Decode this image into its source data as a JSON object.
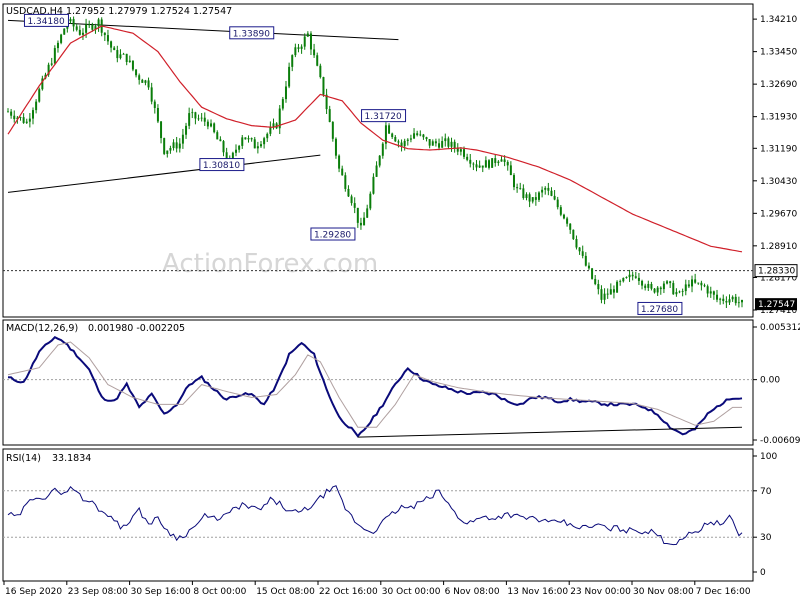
{
  "header": {
    "symbol_line": "USDCAD,H4  1.27952 1.27979 1.27524 1.27547",
    "watermark": "ActionForex.com"
  },
  "colors": {
    "candle": "#0a7d0a",
    "ma": "#d0202a",
    "macd": "#0a0a7a",
    "signal": "#b0a0a0",
    "trend": "#000000",
    "label_border": "#1a1a8a",
    "grid_dash": "#a0a0a0"
  },
  "chart_data": [
    {
      "type": "candlestick",
      "title": "USDCAD,H4",
      "ohlc_header": "1.27952 1.27979 1.27524 1.27547",
      "ylim": [
        1.2741,
        1.3447
      ],
      "y_ticks": [
        "1.34210",
        "1.33450",
        "1.32690",
        "1.31930",
        "1.31190",
        "1.30430",
        "1.29670",
        "1.28910",
        "1.28170",
        "1.27410"
      ],
      "y_tick_values": [
        1.3421,
        1.3345,
        1.3269,
        1.3193,
        1.3119,
        1.3043,
        1.2967,
        1.2891,
        1.2817,
        1.2741
      ],
      "price_anchors": {
        "x": [
          0,
          6,
          12,
          19,
          23,
          29,
          34,
          38,
          41,
          45,
          50,
          55,
          58,
          64,
          71,
          75,
          79,
          84,
          86,
          91,
          96,
          101,
          106,
          110,
          113,
          116,
          121,
          126,
          130,
          135,
          140,
          145,
          150,
          155,
          158,
          163,
          168,
          172,
          179,
          184,
          190,
          196,
          201,
          206,
          210,
          215,
          218,
          223,
          227,
          232,
          235
        ],
        "y": [
          1.3205,
          1.318,
          1.329,
          1.3418,
          1.339,
          1.3415,
          1.334,
          1.333,
          1.329,
          1.327,
          1.3115,
          1.313,
          1.3195,
          1.318,
          1.3085,
          1.315,
          1.3125,
          1.316,
          1.3175,
          1.3335,
          1.3385,
          1.325,
          1.307,
          1.3,
          1.2928,
          1.301,
          1.3172,
          1.3125,
          1.3155,
          1.313,
          1.3132,
          1.3115,
          1.308,
          1.3085,
          1.3102,
          1.302,
          1.2995,
          1.3025,
          1.295,
          1.286,
          1.2768,
          1.2802,
          1.2825,
          1.2785,
          1.2806,
          1.2775,
          1.2805,
          1.2795,
          1.2765,
          1.2769,
          1.2755
        ]
      },
      "moving_average": {
        "x": [
          0,
          10,
          20,
          30,
          40,
          48,
          55,
          62,
          70,
          78,
          85,
          92,
          100,
          107,
          113,
          120,
          128,
          135,
          145,
          150,
          160,
          170,
          180,
          190,
          200,
          210,
          220,
          225,
          235
        ],
        "y": [
          1.3152,
          1.3265,
          1.3365,
          1.3405,
          1.3388,
          1.3345,
          1.3275,
          1.3215,
          1.3188,
          1.3172,
          1.3168,
          1.3185,
          1.3245,
          1.323,
          1.3178,
          1.3138,
          1.3118,
          1.3115,
          1.312,
          1.3115,
          1.3098,
          1.3075,
          1.3045,
          1.3005,
          1.2965,
          1.2935,
          1.2905,
          1.289,
          1.2877
        ]
      },
      "current_level": "1.28330",
      "current_level_value": 1.2833,
      "last_price": "1.27547",
      "last_price_value": 1.27547,
      "annotations": [
        {
          "text": "1.34180",
          "x": 20,
          "value": 1.3418
        },
        {
          "text": "1.33890",
          "x": 87,
          "value": 1.3389
        },
        {
          "text": "1.30810",
          "x": 64,
          "value": 1.3081
        },
        {
          "text": "1.29280",
          "x": 113,
          "value": 1.2928
        },
        {
          "text": "1.31720",
          "x": 126,
          "value": 1.3172
        },
        {
          "text": "1.27680",
          "x": 210,
          "value": 1.2768
        }
      ],
      "trendlines": [
        {
          "x": [
            0,
            125
          ],
          "y": [
            1.3418,
            1.3373
          ]
        },
        {
          "x": [
            0,
            100
          ],
          "y": [
            1.3016,
            1.3103
          ]
        }
      ]
    },
    {
      "type": "line",
      "title": "MACD(12,26,9)",
      "header_values": "0.001980 -0.002205",
      "ylim": [
        -0.006092,
        0.005312
      ],
      "y_ticks": [
        "0.005312",
        "0.00",
        "-0.006092"
      ],
      "y_tick_values": [
        0.005312,
        0.0,
        -0.006092
      ],
      "series": [
        {
          "role": "macd",
          "x": [
            0,
            5,
            10,
            15,
            18,
            22,
            26,
            30,
            34,
            38,
            42,
            46,
            50,
            54,
            58,
            62,
            66,
            70,
            74,
            78,
            82,
            86,
            90,
            94,
            98,
            102,
            106,
            110,
            112,
            116,
            120,
            124,
            128,
            132,
            136,
            140,
            144,
            148,
            152,
            156,
            160,
            164,
            168,
            172,
            176,
            180,
            184,
            188,
            192,
            196,
            200,
            204,
            208,
            212,
            216,
            220,
            224,
            228,
            232
          ],
          "y": [
            0.0002,
            -0.0003,
            0.0028,
            0.0043,
            0.0038,
            0.0025,
            0.001,
            -0.0018,
            -0.0022,
            -0.0005,
            -0.0028,
            -0.0015,
            -0.0035,
            -0.0025,
            -0.0005,
            0.0002,
            -0.001,
            -0.002,
            -0.0015,
            -0.0015,
            -0.0025,
            -0.0005,
            0.0025,
            0.0037,
            0.0025,
            -0.001,
            -0.0038,
            -0.005,
            -0.0058,
            -0.0043,
            -0.0025,
            -0.0005,
            0.0012,
            0.0002,
            -0.0005,
            -0.0008,
            -0.0012,
            -0.0014,
            -0.0013,
            -0.0015,
            -0.0022,
            -0.0025,
            -0.0018,
            -0.0018,
            -0.0022,
            -0.002,
            -0.0022,
            -0.0023,
            -0.0025,
            -0.0025,
            -0.0025,
            -0.0028,
            -0.0035,
            -0.0048,
            -0.0055,
            -0.005,
            -0.0035,
            -0.0025,
            -0.0018
          ]
        },
        {
          "role": "signal",
          "x": [
            0,
            10,
            16,
            20,
            26,
            32,
            40,
            48,
            56,
            62,
            70,
            78,
            86,
            92,
            96,
            100,
            106,
            112,
            118,
            124,
            130,
            136,
            144,
            152,
            160,
            170,
            180,
            190,
            200,
            208,
            214,
            220,
            226,
            232
          ],
          "y": [
            0.0005,
            0.0012,
            0.0035,
            0.0038,
            0.0022,
            -0.0005,
            -0.0018,
            -0.0025,
            -0.0025,
            -0.0005,
            -0.0012,
            -0.0018,
            -0.0015,
            0.0005,
            0.0025,
            0.0018,
            -0.0018,
            -0.0048,
            -0.0048,
            -0.0025,
            0.0005,
            -0.0002,
            -0.0008,
            -0.0012,
            -0.0015,
            -0.0018,
            -0.002,
            -0.0022,
            -0.0024,
            -0.003,
            -0.0038,
            -0.0046,
            -0.0042,
            -0.0028
          ]
        }
      ],
      "trendline": {
        "x": [
          112,
          235
        ],
        "y": [
          -0.0058,
          -0.0048
        ]
      }
    },
    {
      "type": "line",
      "title": "RSI(14)",
      "header_values": "33.1834",
      "ylim": [
        0,
        100
      ],
      "y_ticks": [
        "100",
        "70",
        "30",
        "0"
      ],
      "y_tick_values": [
        100,
        70,
        30,
        0
      ],
      "levels": [
        70,
        30
      ],
      "x": [
        0,
        3,
        6,
        9,
        12,
        15,
        18,
        21,
        24,
        27,
        30,
        33,
        36,
        39,
        42,
        45,
        48,
        51,
        54,
        57,
        60,
        63,
        66,
        69,
        72,
        75,
        78,
        81,
        84,
        87,
        90,
        93,
        96,
        99,
        102,
        105,
        108,
        111,
        114,
        117,
        120,
        123,
        126,
        129,
        132,
        135,
        138,
        141,
        144,
        147,
        150,
        153,
        156,
        159,
        162,
        165,
        168,
        171,
        174,
        177,
        180,
        183,
        186,
        189,
        192,
        195,
        198,
        201,
        204,
        207,
        210,
        213,
        216,
        219,
        222,
        225,
        228,
        231,
        234
      ],
      "y": [
        50,
        47,
        58,
        66,
        64,
        70,
        69,
        73,
        62,
        60,
        52,
        49,
        38,
        45,
        53,
        42,
        46,
        36,
        29,
        33,
        40,
        48,
        46,
        48,
        53,
        58,
        55,
        54,
        62,
        59,
        52,
        51,
        55,
        61,
        69,
        72,
        55,
        44,
        37,
        35,
        43,
        50,
        56,
        55,
        60,
        64,
        70,
        58,
        48,
        42,
        45,
        48,
        46,
        50,
        49,
        46,
        47,
        44,
        42,
        44,
        40,
        39,
        38,
        41,
        37,
        38,
        36,
        36,
        35,
        34,
        27,
        24,
        30,
        33,
        38,
        44,
        41,
        47,
        33
      ]
    }
  ],
  "x_axis": {
    "count": 236,
    "labels": [
      "16 Sep 2020",
      "23 Sep 08:00",
      "30 Sep 16:00",
      "8 Oct 00:00",
      "15 Oct 08:00",
      "22 Oct 16:00",
      "30 Oct 00:00",
      "6 Nov 08:00",
      "13 Nov 16:00",
      "23 Nov 00:00",
      "30 Nov 08:00",
      "7 Dec 16:00"
    ],
    "label_index": [
      0,
      25,
      50,
      75,
      100,
      125,
      150,
      175,
      200,
      225,
      250,
      275
    ]
  }
}
